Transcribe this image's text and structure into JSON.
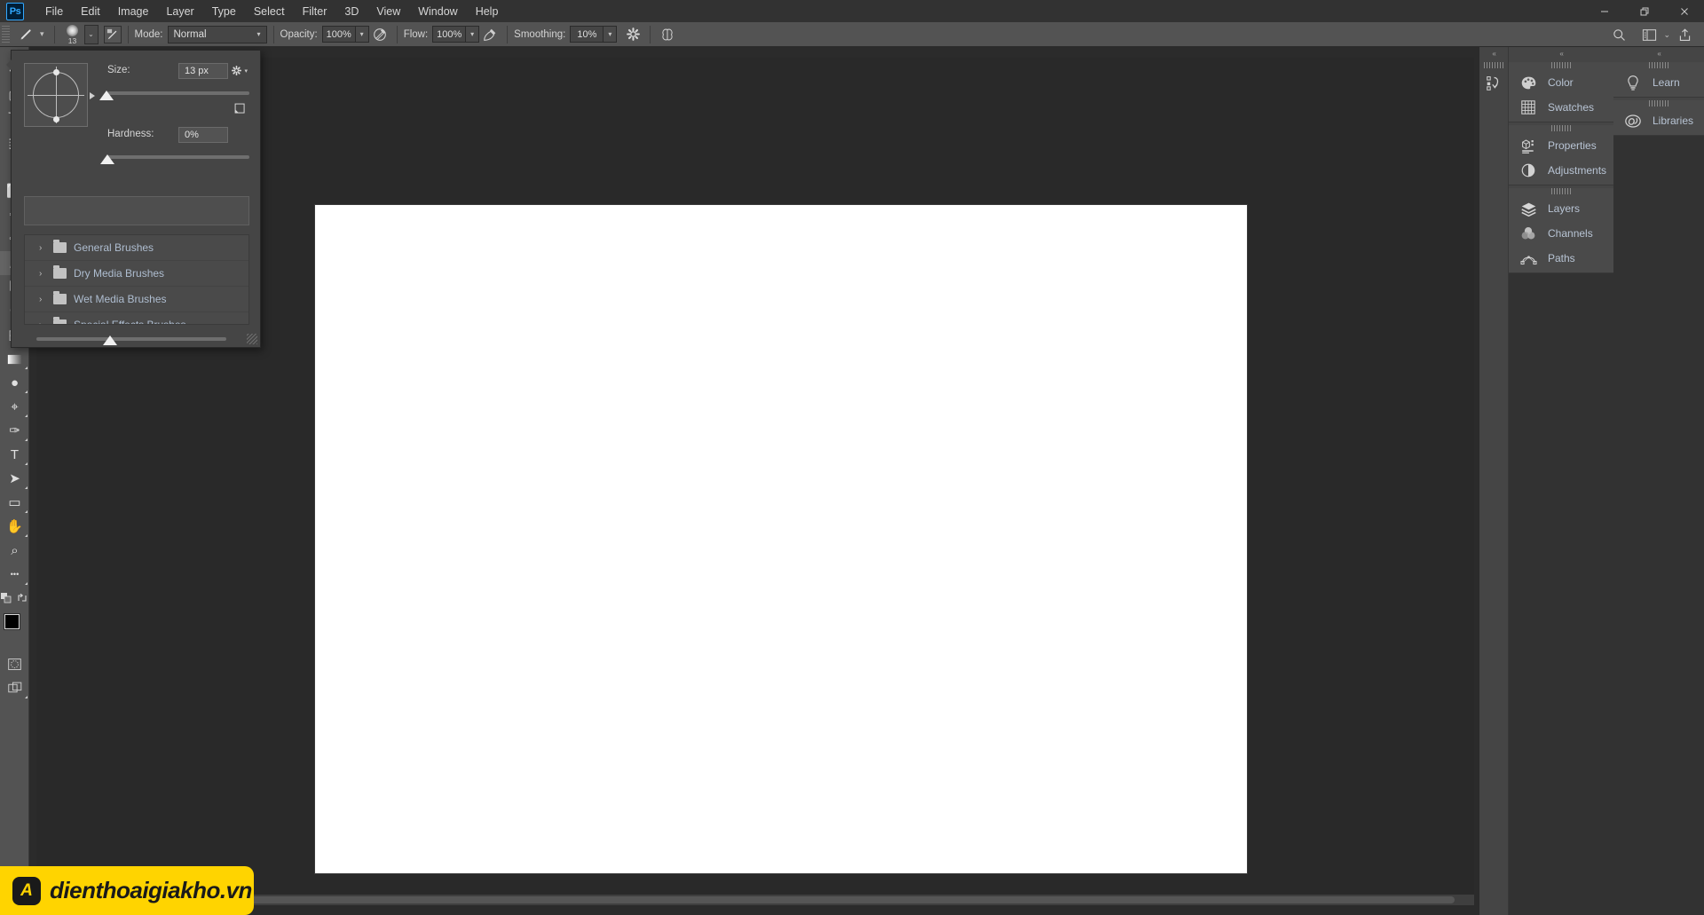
{
  "app": {
    "logo": "Ps",
    "name": "Adobe Photoshop"
  },
  "menubar": {
    "items": [
      {
        "label": "File"
      },
      {
        "label": "Edit"
      },
      {
        "label": "Image"
      },
      {
        "label": "Layer"
      },
      {
        "label": "Type"
      },
      {
        "label": "Select"
      },
      {
        "label": "Filter"
      },
      {
        "label": "3D"
      },
      {
        "label": "View"
      },
      {
        "label": "Window"
      },
      {
        "label": "Help"
      }
    ],
    "window_controls": [
      {
        "name": "minimize",
        "glyph": "—"
      },
      {
        "name": "maximize",
        "glyph": "❐"
      },
      {
        "name": "close",
        "glyph": "✕"
      }
    ]
  },
  "options_bar": {
    "tool_icon": "brush-icon",
    "brush_size_badge": "13",
    "preset_picker_caret": "⌄",
    "brush_panel_toggle_icon": "brush-settings-icon",
    "mode_label": "Mode:",
    "mode_value": "Normal",
    "opacity_label": "Opacity:",
    "opacity_value": "100%",
    "opacity_pressure_icon": "pressure-opacity-icon",
    "flow_label": "Flow:",
    "flow_value": "100%",
    "airbrush_icon": "airbrush-icon",
    "smoothing_label": "Smoothing:",
    "smoothing_value": "10%",
    "smoothing_options_icon": "gear-icon",
    "symmetry_icon": "symmetry-butterfly-icon",
    "search_icon": "search-icon",
    "workspace_icon": "workspace-switcher-icon",
    "workspace_caret": "⌄",
    "share_icon": "share-icon"
  },
  "tool_panel": {
    "collapse_glyph": "»",
    "tools": [
      {
        "name": "move-tool",
        "glyph": "✥",
        "has_flyout": true
      },
      {
        "name": "marquee-tool",
        "glyph": "▢",
        "has_flyout": true
      },
      {
        "name": "lasso-tool",
        "glyph": "⤵",
        "has_flyout": true
      },
      {
        "name": "object-selection-tool",
        "glyph": "⬚",
        "has_flyout": true
      },
      {
        "name": "crop-tool",
        "glyph": "⌗",
        "has_flyout": true
      },
      {
        "name": "frame-tool",
        "glyph": "⬜",
        "has_flyout": false
      },
      {
        "name": "eyedropper-tool",
        "glyph": "✒",
        "has_flyout": true
      },
      {
        "name": "spot-healing-tool",
        "glyph": "❁",
        "has_flyout": true
      },
      {
        "name": "brush-tool",
        "glyph": "brush",
        "has_flyout": true,
        "selected": true
      },
      {
        "name": "clone-stamp-tool",
        "glyph": "⎘",
        "has_flyout": true
      },
      {
        "name": "history-brush-tool",
        "glyph": "↺",
        "has_flyout": true
      },
      {
        "name": "eraser-tool",
        "glyph": "◱",
        "has_flyout": true
      },
      {
        "name": "gradient-tool",
        "glyph": "gradient",
        "has_flyout": true
      },
      {
        "name": "blur-tool",
        "glyph": "●",
        "has_flyout": true
      },
      {
        "name": "dodge-tool",
        "glyph": "⌖",
        "has_flyout": true
      },
      {
        "name": "pen-tool",
        "glyph": "✑",
        "has_flyout": true
      },
      {
        "name": "type-tool",
        "glyph": "T",
        "has_flyout": true
      },
      {
        "name": "path-selection-tool",
        "glyph": "➤",
        "has_flyout": true
      },
      {
        "name": "rectangle-tool",
        "glyph": "▭",
        "has_flyout": true
      },
      {
        "name": "hand-tool",
        "glyph": "✋",
        "has_flyout": true
      },
      {
        "name": "zoom-tool",
        "glyph": "⌕",
        "has_flyout": false
      },
      {
        "name": "edit-toolbar-ellipsis",
        "glyph": "•••",
        "has_flyout": true
      }
    ],
    "swap_colors_icon": "swap-colors-icon",
    "default_colors_icon": "default-colors-icon",
    "foreground_color": "#000000",
    "background_color": "#ffffff",
    "quick_mask_icon": "quick-mask-icon",
    "screen_mode_icon": "screen-mode-icon"
  },
  "brush_picker": {
    "thumbnail_name": "brush-tip-preview",
    "gear_icon": "gear-icon",
    "gear_caret": "▾",
    "new_preset_icon": "new-brush-preset-icon",
    "size_label": "Size:",
    "size_value": "13 px",
    "hardness_label": "Hardness:",
    "hardness_value": "0%",
    "search_placeholder": "",
    "search_value": "",
    "folders": [
      {
        "label": "General Brushes",
        "chevron": "›",
        "icon": "folder-icon"
      },
      {
        "label": "Dry Media Brushes",
        "chevron": "›",
        "icon": "folder-icon"
      },
      {
        "label": "Wet Media Brushes",
        "chevron": "›",
        "icon": "folder-icon"
      },
      {
        "label": "Special Effects Brushes",
        "chevron": "›",
        "icon": "folder-icon"
      }
    ],
    "resize_grip_icon": "resize-grip-icon"
  },
  "right_dock": {
    "collapse_glyph": "«",
    "history_strip_icon": "history-icon",
    "groups": [
      {
        "name": "color-group",
        "panels": [
          {
            "label": "Color",
            "icon": "color-palette-icon"
          },
          {
            "label": "Swatches",
            "icon": "swatches-grid-icon"
          }
        ]
      },
      {
        "name": "properties-group",
        "panels": [
          {
            "label": "Properties",
            "icon": "properties-icon"
          },
          {
            "label": "Adjustments",
            "icon": "adjustments-halfcircle-icon"
          }
        ]
      },
      {
        "name": "layers-group",
        "panels": [
          {
            "label": "Layers",
            "icon": "layers-stack-icon"
          },
          {
            "label": "Channels",
            "icon": "channels-venn-icon"
          },
          {
            "label": "Paths",
            "icon": "paths-bezier-icon"
          }
        ]
      }
    ],
    "far_groups": [
      {
        "name": "learn-group",
        "panels": [
          {
            "label": "Learn",
            "icon": "lightbulb-icon"
          }
        ]
      },
      {
        "name": "libraries-group",
        "panels": [
          {
            "label": "Libraries",
            "icon": "libraries-cc-icon"
          }
        ]
      }
    ]
  },
  "document": {
    "canvas_background": "#ffffff",
    "workspace_background": "#292929"
  },
  "watermark": {
    "badge_glyph": "A",
    "text": "dienthoaigiakho.vn",
    "background_color": "#ffd400",
    "text_color": "#1a1a1a"
  }
}
